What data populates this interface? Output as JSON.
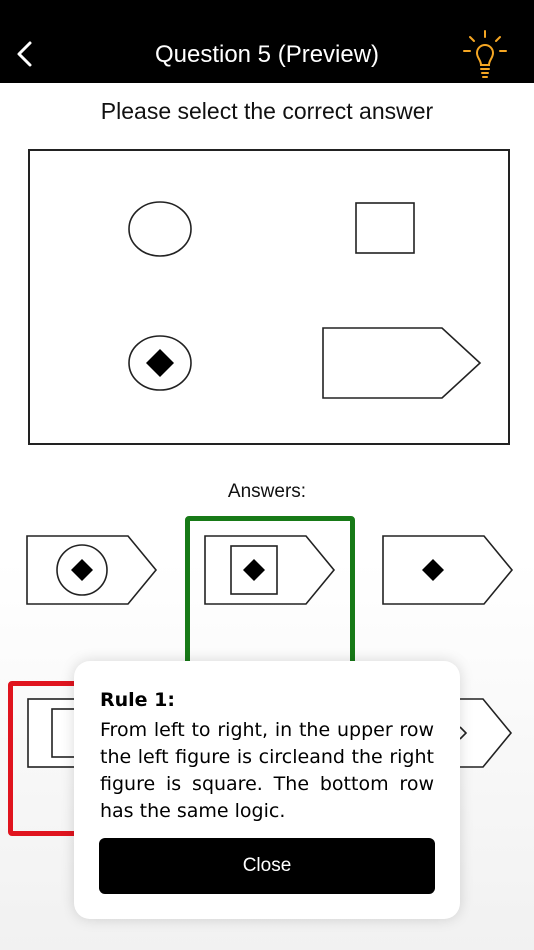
{
  "header": {
    "title": "Question 5 (Preview)",
    "back_icon": "chevron-left-icon",
    "hint_icon": "lightbulb-icon",
    "hint_color": "#f5a623"
  },
  "instruction": "Please select the correct answer",
  "answers_label": "Answers:",
  "selection_colors": {
    "correct": "#177a17",
    "wrong": "#e0141e"
  },
  "popup": {
    "title": "Rule 1:",
    "text": "From left to right, in the upper row the left figure is circleand the right figure is square. The bottom row has the same logic.",
    "close_label": "Close"
  }
}
